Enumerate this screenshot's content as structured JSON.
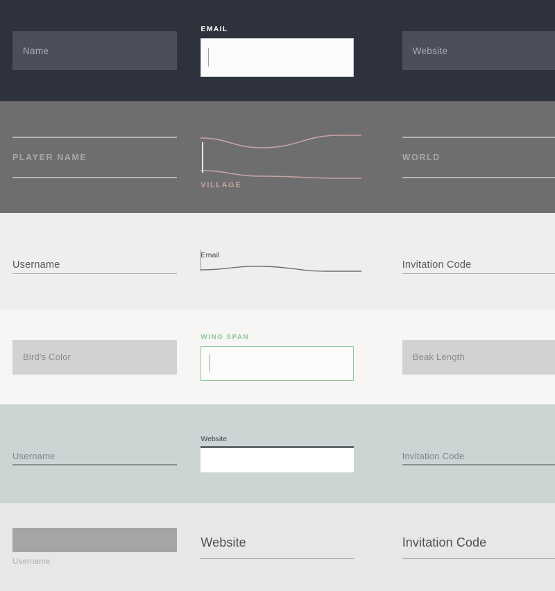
{
  "colors": {
    "section1_bg": "#2e323c",
    "section1_field": "#4a4f59",
    "section2_bg": "#6e6e6e",
    "section2_rule": "#b5b5b5",
    "section2_accent": "#c9a2a2",
    "section3_bg": "#efeeec",
    "section4_bg": "#f7f6f4",
    "section4_field": "#d2d2d2",
    "section4_accent": "#8fc79a",
    "section5_bg": "#ccd4d4",
    "section6_bg": "#e7e7e7",
    "section6_field": "#a5a5a5"
  },
  "sections": [
    {
      "name": "dark-filled-form",
      "fields": [
        {
          "name": "name",
          "label": "",
          "placeholder": "Name",
          "state": "filled"
        },
        {
          "name": "email",
          "label": "EMAIL",
          "placeholder": "",
          "state": "focused"
        },
        {
          "name": "website",
          "label": "",
          "placeholder": "Website",
          "state": "filled"
        }
      ]
    },
    {
      "name": "grey-rule-form",
      "fields": [
        {
          "name": "player-name",
          "label": "",
          "placeholder": "PLAYER NAME",
          "state": "default"
        },
        {
          "name": "village",
          "label": "VILLAGE",
          "placeholder": "",
          "state": "focused"
        },
        {
          "name": "world",
          "label": "",
          "placeholder": "WORLD",
          "state": "default"
        }
      ]
    },
    {
      "name": "light-underline-form",
      "fields": [
        {
          "name": "username",
          "label": "",
          "placeholder": "Username",
          "state": "default"
        },
        {
          "name": "email",
          "label": "Email",
          "placeholder": "",
          "state": "focused"
        },
        {
          "name": "invitation-code",
          "label": "",
          "placeholder": "Invitation Code",
          "state": "default"
        }
      ]
    },
    {
      "name": "green-accent-form",
      "fields": [
        {
          "name": "birds-color",
          "label": "",
          "placeholder": "Bird's Color",
          "state": "filled"
        },
        {
          "name": "wing-span",
          "label": "WING SPAN",
          "placeholder": "",
          "state": "focused"
        },
        {
          "name": "beak-length",
          "label": "",
          "placeholder": "Beak Length",
          "state": "filled"
        }
      ]
    },
    {
      "name": "bluegrey-form",
      "fields": [
        {
          "name": "username",
          "label": "",
          "placeholder": "Username",
          "state": "default"
        },
        {
          "name": "website",
          "label": "Website",
          "placeholder": "",
          "state": "focused"
        },
        {
          "name": "invitation-code",
          "label": "",
          "placeholder": "Invitation Code",
          "state": "default"
        }
      ]
    },
    {
      "name": "lightgrey-form",
      "fields": [
        {
          "name": "username",
          "label": "Username",
          "placeholder": "",
          "state": "focused"
        },
        {
          "name": "website",
          "label": "",
          "placeholder": "Website",
          "state": "default"
        },
        {
          "name": "invitation-code",
          "label": "",
          "placeholder": "Invitation Code",
          "state": "default"
        }
      ]
    }
  ]
}
